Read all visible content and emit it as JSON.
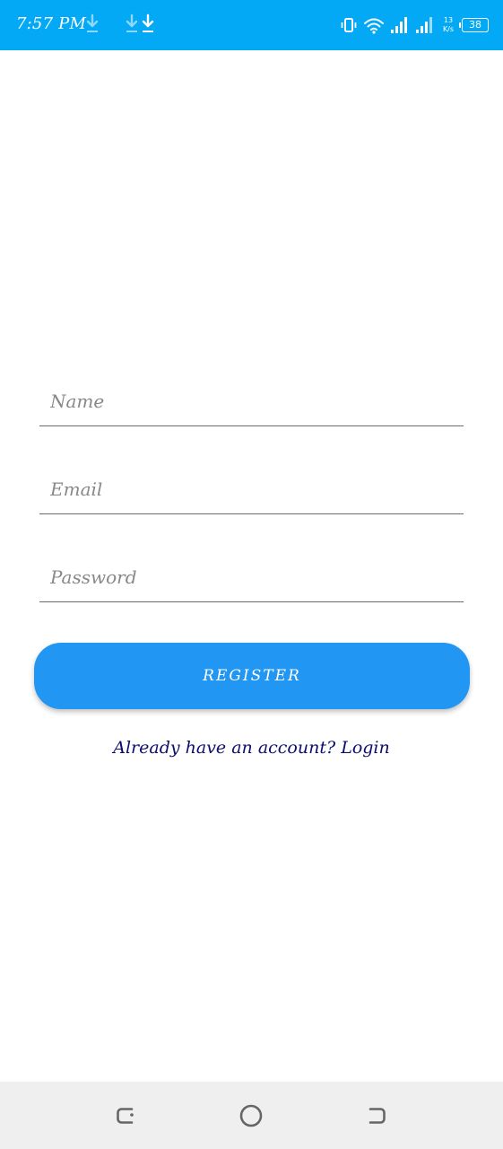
{
  "status_bar": {
    "time": "7:57 PM",
    "network_speed_value": "13",
    "network_speed_unit": "K/s",
    "battery_level": "38",
    "background_color": "#03A9F4",
    "icons": [
      "download-icon",
      "download-icon",
      "download-icon",
      "vibrate-icon",
      "wifi-icon",
      "signal-icon",
      "signal-icon",
      "battery-icon"
    ]
  },
  "form": {
    "name_placeholder": "Name",
    "email_placeholder": "Email",
    "password_placeholder": "Password",
    "name_value": "",
    "email_value": "",
    "password_value": ""
  },
  "register_button": {
    "label": "REGISTER",
    "color": "#2196F3"
  },
  "login_link": {
    "text": "Already have an account? Login",
    "color": "#0d0d6e"
  },
  "nav_bar": {
    "icons": [
      "back-icon",
      "home-icon",
      "recents-icon"
    ]
  }
}
